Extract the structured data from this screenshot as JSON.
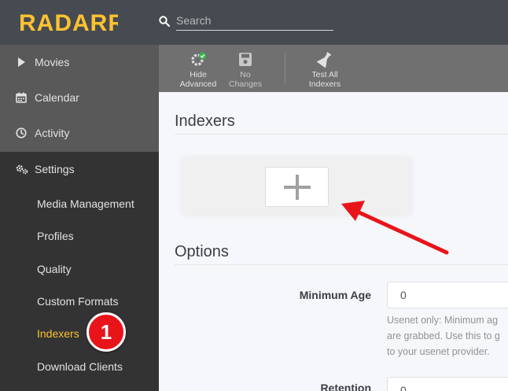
{
  "header": {
    "logo_text": "RADARR",
    "search": {
      "placeholder": "Search",
      "value": ""
    }
  },
  "sidebar": {
    "items": [
      {
        "label": "Movies",
        "icon": "play-icon"
      },
      {
        "label": "Calendar",
        "icon": "calendar-icon"
      },
      {
        "label": "Activity",
        "icon": "clock-icon"
      },
      {
        "label": "Settings",
        "icon": "cogs-icon"
      }
    ],
    "settings_subitems": [
      {
        "label": "Media Management"
      },
      {
        "label": "Profiles"
      },
      {
        "label": "Quality"
      },
      {
        "label": "Custom Formats"
      },
      {
        "label": "Indexers",
        "selected": true
      },
      {
        "label": "Download Clients"
      }
    ]
  },
  "toolbar": {
    "hide_advanced": {
      "line1": "Hide",
      "line2": "Advanced"
    },
    "no_changes": {
      "line1": "No",
      "line2": "Changes"
    },
    "test_all": {
      "line1": "Test All",
      "line2": "Indexers"
    }
  },
  "content": {
    "indexers_title": "Indexers",
    "options_title": "Options",
    "minimum_age": {
      "label": "Minimum Age",
      "value": "0",
      "help_lines": [
        "Usenet only: Minimum ag",
        "are grabbed. Use this to g",
        "to your usenet provider."
      ]
    },
    "retention": {
      "label": "Retention",
      "value": "0"
    }
  },
  "annotation": {
    "badge_number": "1"
  },
  "colors": {
    "header_bg": "#464b51",
    "sidebar_bg": "#595959",
    "sidebar_active_bg": "#333333",
    "accent": "#ffc230",
    "badge_red": "#e8141a"
  }
}
